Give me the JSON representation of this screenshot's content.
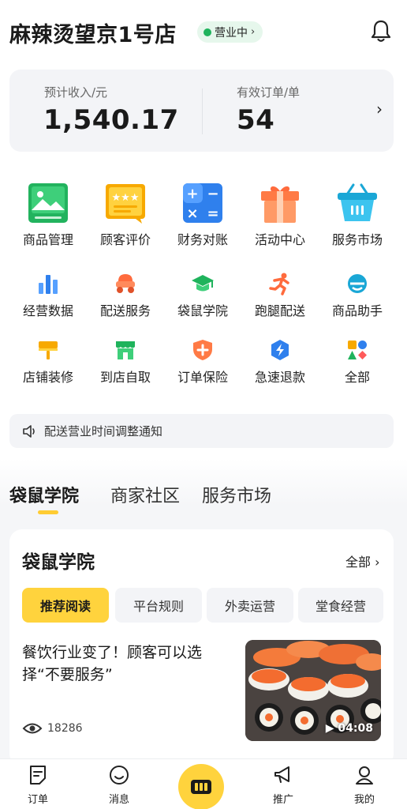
{
  "header": {
    "store_name": "麻辣烫望京1号店",
    "status_label": "营业中",
    "status_chevron": "›",
    "bell_icon": "bell-icon",
    "status_color": "#1fb35c"
  },
  "stats": {
    "income_label": "预计收入/元",
    "income_value": "1,540.17",
    "orders_label": "有效订单/单",
    "orders_value": "54",
    "chevron": "›"
  },
  "grid": {
    "items": [
      {
        "label": "商品管理",
        "icon": "product-management-icon"
      },
      {
        "label": "顾客评价",
        "icon": "customer-review-icon"
      },
      {
        "label": "财务对账",
        "icon": "finance-calculator-icon"
      },
      {
        "label": "活动中心",
        "icon": "gift-box-icon"
      },
      {
        "label": "服务市场",
        "icon": "shopping-basket-icon"
      },
      {
        "label": "经营数据",
        "icon": "bar-chart-icon"
      },
      {
        "label": "配送服务",
        "icon": "delivery-scooter-icon"
      },
      {
        "label": "袋鼠学院",
        "icon": "graduation-cap-icon"
      },
      {
        "label": "跑腿配送",
        "icon": "running-man-icon"
      },
      {
        "label": "商品助手",
        "icon": "product-assistant-icon"
      },
      {
        "label": "店铺装修",
        "icon": "paint-roller-icon"
      },
      {
        "label": "到店自取",
        "icon": "storefront-icon"
      },
      {
        "label": "订单保险",
        "icon": "shield-plus-icon"
      },
      {
        "label": "急速退款",
        "icon": "lightning-shield-icon"
      },
      {
        "label": "全部",
        "icon": "all-apps-icon"
      }
    ]
  },
  "notice": {
    "text": "配送营业时间调整通知",
    "icon": "speaker-icon"
  },
  "tabs": {
    "items": [
      "袋鼠学院",
      "商家社区",
      "服务市场"
    ],
    "active_index": 0,
    "accent": "#ffcc33"
  },
  "academy": {
    "title": "袋鼠学院",
    "all_label": "全部",
    "all_chevron": "›",
    "chips": [
      "推荐阅读",
      "平台规则",
      "外卖运营",
      "堂食经营"
    ],
    "active_chip": 0,
    "article": {
      "title": "餐饮行业变了！顾客可以选择“不要服务”",
      "views": "18286",
      "duration": "04:08"
    }
  },
  "bottom_nav": {
    "items": [
      {
        "label": "订单",
        "icon": "order-icon"
      },
      {
        "label": "消息",
        "icon": "message-icon"
      },
      {
        "label": "",
        "icon": "store-center-icon"
      },
      {
        "label": "推广",
        "icon": "megaphone-icon"
      },
      {
        "label": "我的",
        "icon": "profile-icon"
      }
    ]
  }
}
